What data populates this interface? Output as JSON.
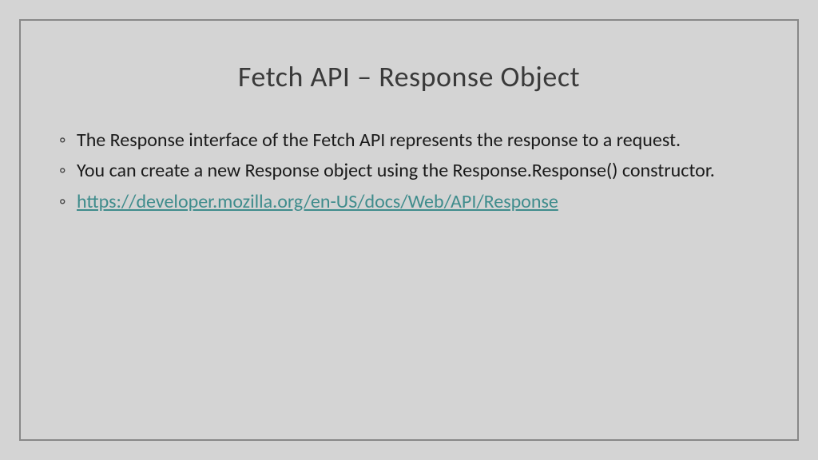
{
  "slide": {
    "title": "Fetch API – Response Object",
    "bullets": [
      {
        "text": "The Response interface of the Fetch API represents the response to a request.",
        "isLink": false
      },
      {
        "text": "You can create a new Response object using the Response.Response() constructor.",
        "isLink": false
      },
      {
        "text": "https://developer.mozilla.org/en-US/docs/Web/API/Response",
        "isLink": true
      }
    ]
  }
}
